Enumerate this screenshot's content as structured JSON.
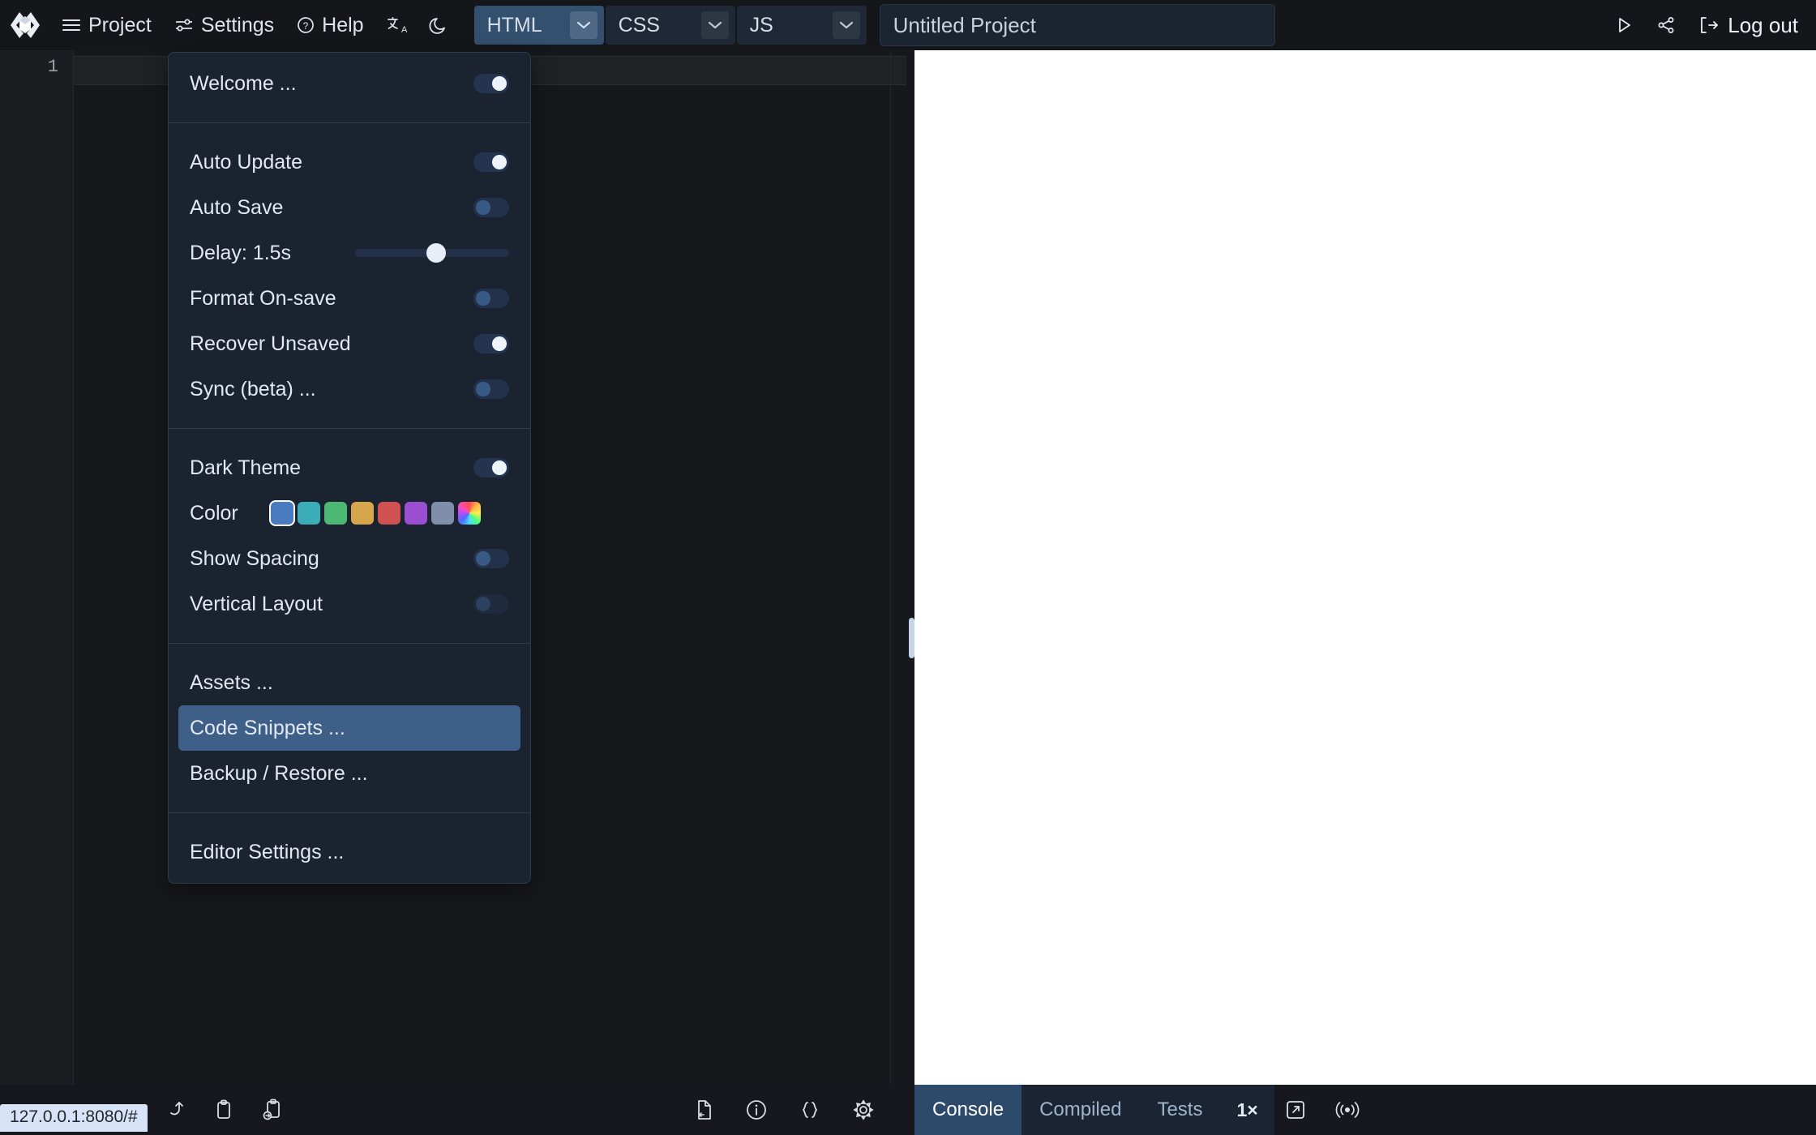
{
  "topbar": {
    "logo_icon": "code-brackets-logo-icon",
    "menu_items": [
      {
        "label": "Project",
        "icon": "hamburger-menu-icon"
      },
      {
        "label": "Settings",
        "icon": "sliders-icon"
      },
      {
        "label": "Help",
        "icon": "question-circle-icon"
      }
    ],
    "translate_icon": "translate-language-icon",
    "theme_icon": "moon-icon",
    "languages": [
      {
        "label": "HTML",
        "active": true
      },
      {
        "label": "CSS",
        "active": false
      },
      {
        "label": "JS",
        "active": false
      }
    ],
    "project_name": "Untitled Project",
    "project_name_placeholder": "Untitled Project",
    "run_icon": "play-run-icon",
    "share_icon": "share-network-icon",
    "logout_label": "Log out",
    "logout_icon": "logout-arrow-icon"
  },
  "editor": {
    "line_numbers": [
      "1"
    ],
    "content": ""
  },
  "menu": {
    "groups": [
      {
        "items": [
          {
            "label": "Welcome ...",
            "control": "toggle",
            "state": "on"
          }
        ]
      },
      {
        "items": [
          {
            "label": "Auto Update",
            "control": "toggle",
            "state": "on"
          },
          {
            "label": "Auto Save",
            "control": "toggle",
            "state": "off"
          },
          {
            "label": "Delay: 1.5s",
            "control": "slider",
            "value": 46
          },
          {
            "label": "Format On-save",
            "control": "toggle",
            "state": "off"
          },
          {
            "label": "Recover Unsaved",
            "control": "toggle",
            "state": "on"
          },
          {
            "label": "Sync (beta) ...",
            "control": "toggle",
            "state": "off"
          }
        ]
      },
      {
        "items": [
          {
            "label": "Dark Theme",
            "control": "toggle",
            "state": "on"
          },
          {
            "label": "Color",
            "control": "swatches"
          },
          {
            "label": "Show Spacing",
            "control": "toggle",
            "state": "off"
          },
          {
            "label": "Vertical Layout",
            "control": "toggle",
            "state": "off-dim"
          }
        ]
      },
      {
        "items": [
          {
            "label": "Assets ...",
            "control": "none"
          },
          {
            "label": "Code Snippets ...",
            "control": "none",
            "highlighted": true
          },
          {
            "label": "Backup / Restore ...",
            "control": "none"
          }
        ]
      },
      {
        "items": [
          {
            "label": "Editor Settings ...",
            "control": "none"
          }
        ]
      }
    ],
    "colors": [
      "#4a7ac0",
      "#3aadb8",
      "#4cb873",
      "#d7a64a",
      "#cf5152",
      "#9a4fd0",
      "#7f8fab",
      "rainbow"
    ],
    "selected_color_index": 0,
    "highlight_color": "#3e5f87"
  },
  "bottombar": {
    "url_tooltip": "127.0.0.1:8080/#",
    "left_icons": [
      "redo-arrow-icon",
      "clipboard-icon",
      "clipboard-paste-link-icon"
    ],
    "center_icons": [
      "file-link-icon",
      "info-circle-icon",
      "braces-format-icon",
      "gear-settings-icon"
    ],
    "console_tabs": [
      {
        "label": "Console",
        "active": true
      },
      {
        "label": "Compiled",
        "active": false
      },
      {
        "label": "Tests",
        "active": false
      }
    ],
    "zoom_level": "1×",
    "right_icons": [
      "open-external-icon",
      "broadcast-live-icon"
    ]
  }
}
